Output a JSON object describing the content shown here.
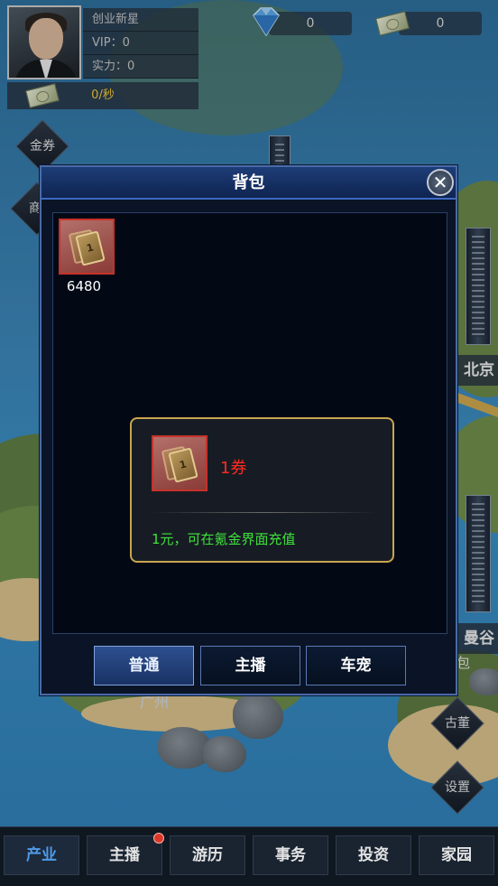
{
  "profile": {
    "name": "创业新星",
    "vip": "VIP：0",
    "power": "实力：0",
    "income": "0/秒"
  },
  "resources": {
    "diamonds": "0",
    "cash": "0",
    "diamond_icon": "diamond-icon",
    "cash_icon": "cash-icon"
  },
  "side_buttons": {
    "coupon": "金券",
    "shop_partial": "商",
    "bag_partial": "包",
    "antiques": "古董",
    "settings": "设置"
  },
  "map_labels": {
    "beijing": "北京",
    "bangkok": "曼谷",
    "guangzhou": "广州"
  },
  "bag": {
    "title": "背包",
    "close_icon": "close-icon",
    "items": [
      {
        "icon": "ticket-icon",
        "ticket_number": "1",
        "count": "6480"
      }
    ],
    "tooltip": {
      "ticket_number": "1",
      "name": "1券",
      "description": "1元，可在氪金界面充值"
    },
    "tabs": [
      {
        "label": "普通",
        "active": true
      },
      {
        "label": "主播",
        "active": false
      },
      {
        "label": "车宠",
        "active": false
      }
    ]
  },
  "bottom_nav": [
    {
      "label": "产业",
      "active": true
    },
    {
      "label": "主播",
      "active": false,
      "badge": true
    },
    {
      "label": "游历",
      "active": false
    },
    {
      "label": "事务",
      "active": false
    },
    {
      "label": "投资",
      "active": false
    },
    {
      "label": "家园",
      "active": false
    }
  ],
  "colors": {
    "accent": "#4a6aa8",
    "item_name": "#ff2a1f",
    "item_desc": "#3ee23a",
    "income": "#f2c73a"
  }
}
